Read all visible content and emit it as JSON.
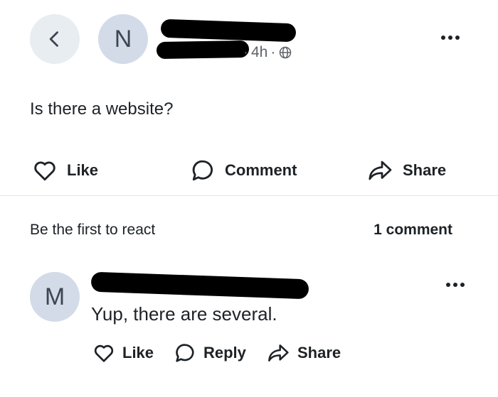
{
  "post": {
    "author_initial": "N",
    "time": "4h",
    "separator": "·",
    "text": "Is there a website?",
    "actions": {
      "like": "Like",
      "comment": "Comment",
      "share": "Share"
    }
  },
  "reactions": {
    "prompt": "Be the first to react",
    "comment_count": "1 comment"
  },
  "comment": {
    "author_initial": "M",
    "text": "Yup, there are several.",
    "actions": {
      "like": "Like",
      "reply": "Reply",
      "share": "Share"
    }
  }
}
